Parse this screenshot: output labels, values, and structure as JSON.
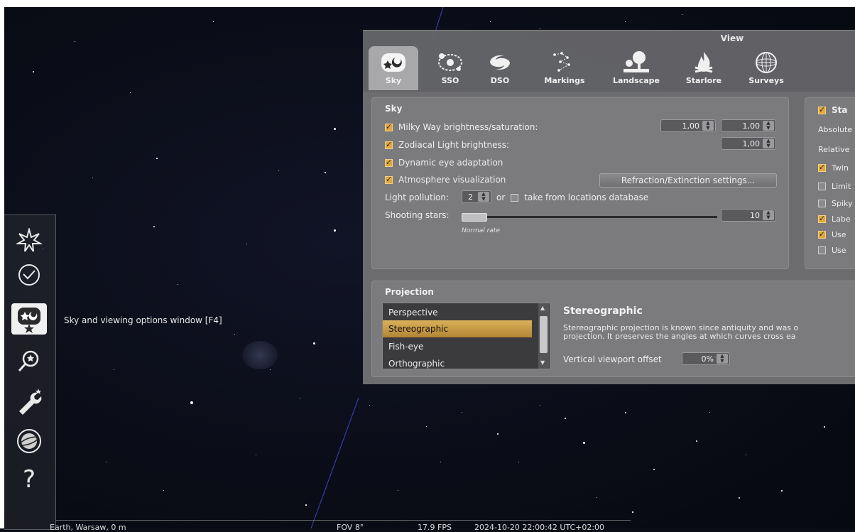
{
  "view_window": {
    "title": "View",
    "tabs": [
      {
        "label": "Sky",
        "icon": "sky-icon",
        "active": true
      },
      {
        "label": "SSO",
        "icon": "solar-system-icon",
        "active": false
      },
      {
        "label": "DSO",
        "icon": "galaxy-icon",
        "active": false
      },
      {
        "label": "Markings",
        "icon": "constellation-icon",
        "active": false
      },
      {
        "label": "Landscape",
        "icon": "tree-icon",
        "active": false
      },
      {
        "label": "Starlore",
        "icon": "campfire-icon",
        "active": false
      },
      {
        "label": "Surveys",
        "icon": "sphere-icon",
        "active": false
      }
    ],
    "sky": {
      "title": "Sky",
      "milky_way_label": "Milky Way brightness/saturation:",
      "milky_way_brightness": "1,00",
      "milky_way_saturation": "1,00",
      "zodiacal_label": "Zodiacal Light brightness:",
      "zodiacal_value": "1,00",
      "dynamic_eye_label": "Dynamic eye adaptation",
      "atmosphere_label": "Atmosphere visualization",
      "refraction_button": "Refraction/Extinction settings...",
      "light_pollution_label": "Light pollution:",
      "light_pollution_value": "2",
      "or_label": "or",
      "take_from_db_label": "take from locations database",
      "shooting_stars_label": "Shooting stars:",
      "shooting_stars_value": "10",
      "shooting_stars_fraction": 0.0,
      "normal_rate_label": "Normal rate"
    },
    "stars": {
      "title": "Sta",
      "absolute_label": "Absolute",
      "relative_label": "Relative",
      "twinkle_label": "Twin",
      "limit_label": "Limit",
      "spiky_label": "Spiky",
      "labels_label": "Labe",
      "use1_label": "Use",
      "use2_label": "Use"
    },
    "projection": {
      "title": "Projection",
      "items": [
        "Perspective",
        "Stereographic",
        "Fish-eye",
        "Orthographic"
      ],
      "selected": "Stereographic",
      "heading": "Stereographic",
      "desc_line1": "Stereographic projection is known since antiquity and was o",
      "desc_line2": "projection. It preserves the angles at which curves cross ea",
      "viewport_offset_label": "Vertical viewport offset",
      "viewport_offset_value": "0%"
    }
  },
  "toolbar": {
    "buttons": [
      {
        "icon": "star-burst-icon",
        "active": false
      },
      {
        "icon": "clock-icon",
        "active": false
      },
      {
        "icon": "sky-view-icon",
        "active": true
      },
      {
        "icon": "search-icon",
        "active": false
      },
      {
        "icon": "wrench-icon",
        "active": false
      },
      {
        "icon": "astronomical-calculations-icon",
        "active": false
      },
      {
        "icon": "help-icon",
        "active": false
      }
    ],
    "tooltip": "Sky and viewing options window  [F4]"
  },
  "status_bar": {
    "location": "Earth, Warsaw, 0 m",
    "fov": "FOV 8°",
    "fps": "17.9 FPS",
    "datetime": "2024-10-20 22:00:42 UTC+02:00"
  }
}
